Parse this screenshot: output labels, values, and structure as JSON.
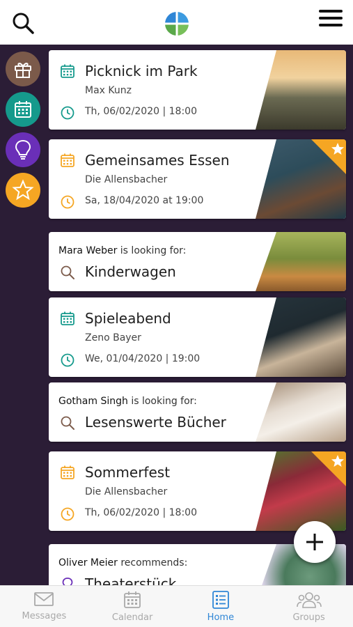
{
  "colors": {
    "teal": "#159a8c",
    "orange": "#f5a623",
    "purple": "#6a2fb8",
    "brown": "#7b5a4a",
    "dark_bg": "#2b1d36",
    "active_tab": "#2f86d6"
  },
  "header": {
    "search_icon": "search-icon",
    "logo_icon": "app-logo",
    "menu_icon": "hamburger-menu-icon"
  },
  "sidebar": {
    "items": [
      {
        "icon": "gift-icon",
        "color": "#7b5a4a"
      },
      {
        "icon": "calendar-icon",
        "color": "#159a8c"
      },
      {
        "icon": "lightbulb-icon",
        "color": "#6a2fb8"
      },
      {
        "icon": "star-icon",
        "color": "#f5a623"
      }
    ]
  },
  "feed": {
    "cards": [
      {
        "type": "event",
        "title": "Picknick im Park",
        "organizer": "Max Kunz",
        "datetime": "Th, 06/02/2020 | 18:00",
        "accent": "#159a8c",
        "featured": false
      },
      {
        "type": "event",
        "title": "Gemeinsames Essen",
        "organizer": "Die Allensbacher",
        "datetime": "Sa, 18/04/2020 at 19:00",
        "accent": "#f5a623",
        "featured": true
      },
      {
        "type": "search",
        "name": "Mara Weber",
        "verb": "is looking for:",
        "title": "Kinderwagen"
      },
      {
        "type": "event",
        "title": "Spieleabend",
        "organizer": "Zeno Bayer",
        "datetime": "We, 01/04/2020 | 19:00",
        "accent": "#159a8c",
        "featured": false
      },
      {
        "type": "search",
        "name": "Gotham Singh",
        "verb": "is looking for:",
        "title": "Lesenswerte Bücher"
      },
      {
        "type": "event",
        "title": "Sommerfest",
        "organizer": "Die Allensbacher",
        "datetime": "Th, 06/02/2020 | 18:00",
        "accent": "#f5a623",
        "featured": true
      },
      {
        "type": "recommend",
        "name": "Oliver Meier",
        "verb": "recommends:",
        "title": "Theaterstück"
      }
    ]
  },
  "fab": {
    "icon": "plus-icon"
  },
  "tabbar": {
    "tabs": [
      {
        "label": "Messages",
        "icon": "envelope-icon",
        "active": false
      },
      {
        "label": "Calendar",
        "icon": "calendar-icon",
        "active": false
      },
      {
        "label": "Home",
        "icon": "list-icon",
        "active": true
      },
      {
        "label": "Groups",
        "icon": "groups-icon",
        "active": false
      }
    ]
  }
}
